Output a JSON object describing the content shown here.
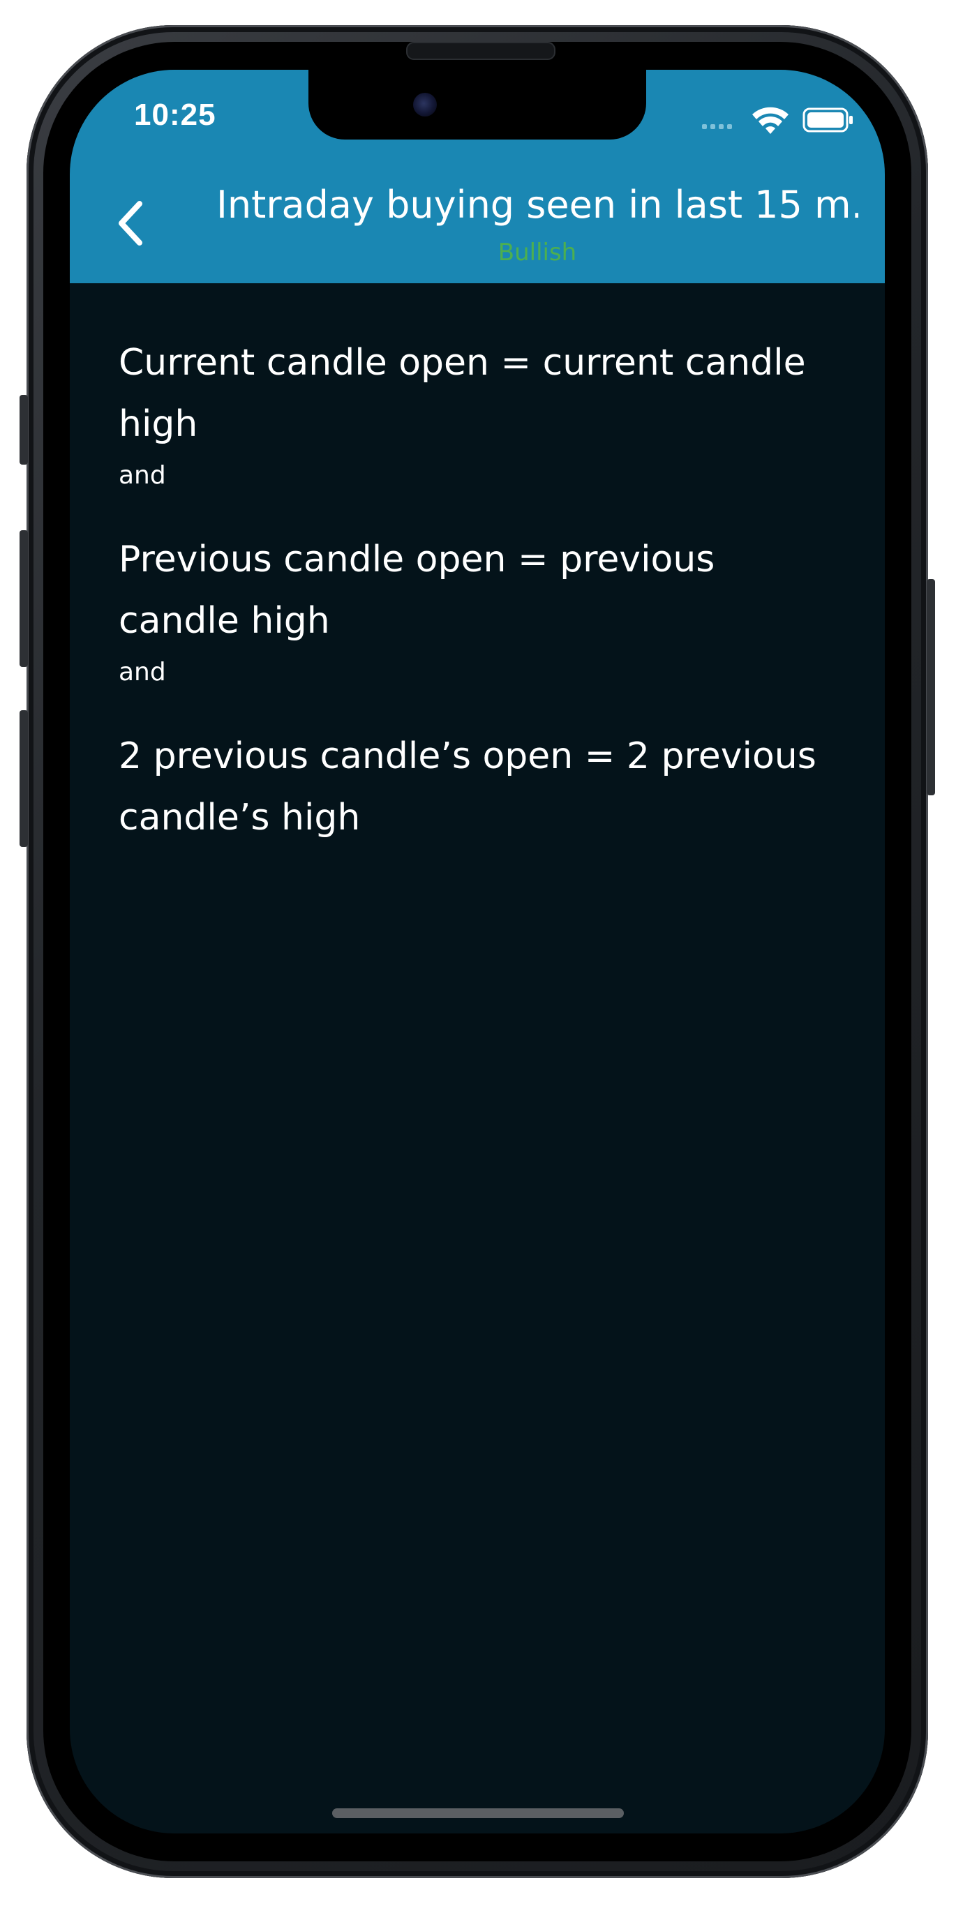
{
  "status_bar": {
    "time": "10:25",
    "icons": [
      "signal-dots-icon",
      "wifi-icon",
      "battery-icon"
    ]
  },
  "header": {
    "back_icon": "chevron-left-icon",
    "title": "Intraday buying seen in last 15 m...",
    "subtitle": "Bullish",
    "background_color": "#1a87b3",
    "subtitle_color": "#4caf50"
  },
  "conditions": [
    {
      "text": "Current candle open = current candle high",
      "joiner": "and"
    },
    {
      "text": "Previous candle open = previous candle high",
      "joiner": "and"
    },
    {
      "text": "2 previous candle’s open = 2 previous candle’s high"
    }
  ],
  "theme": {
    "screen_background": "#04131a",
    "text_color": "#ffffff"
  }
}
